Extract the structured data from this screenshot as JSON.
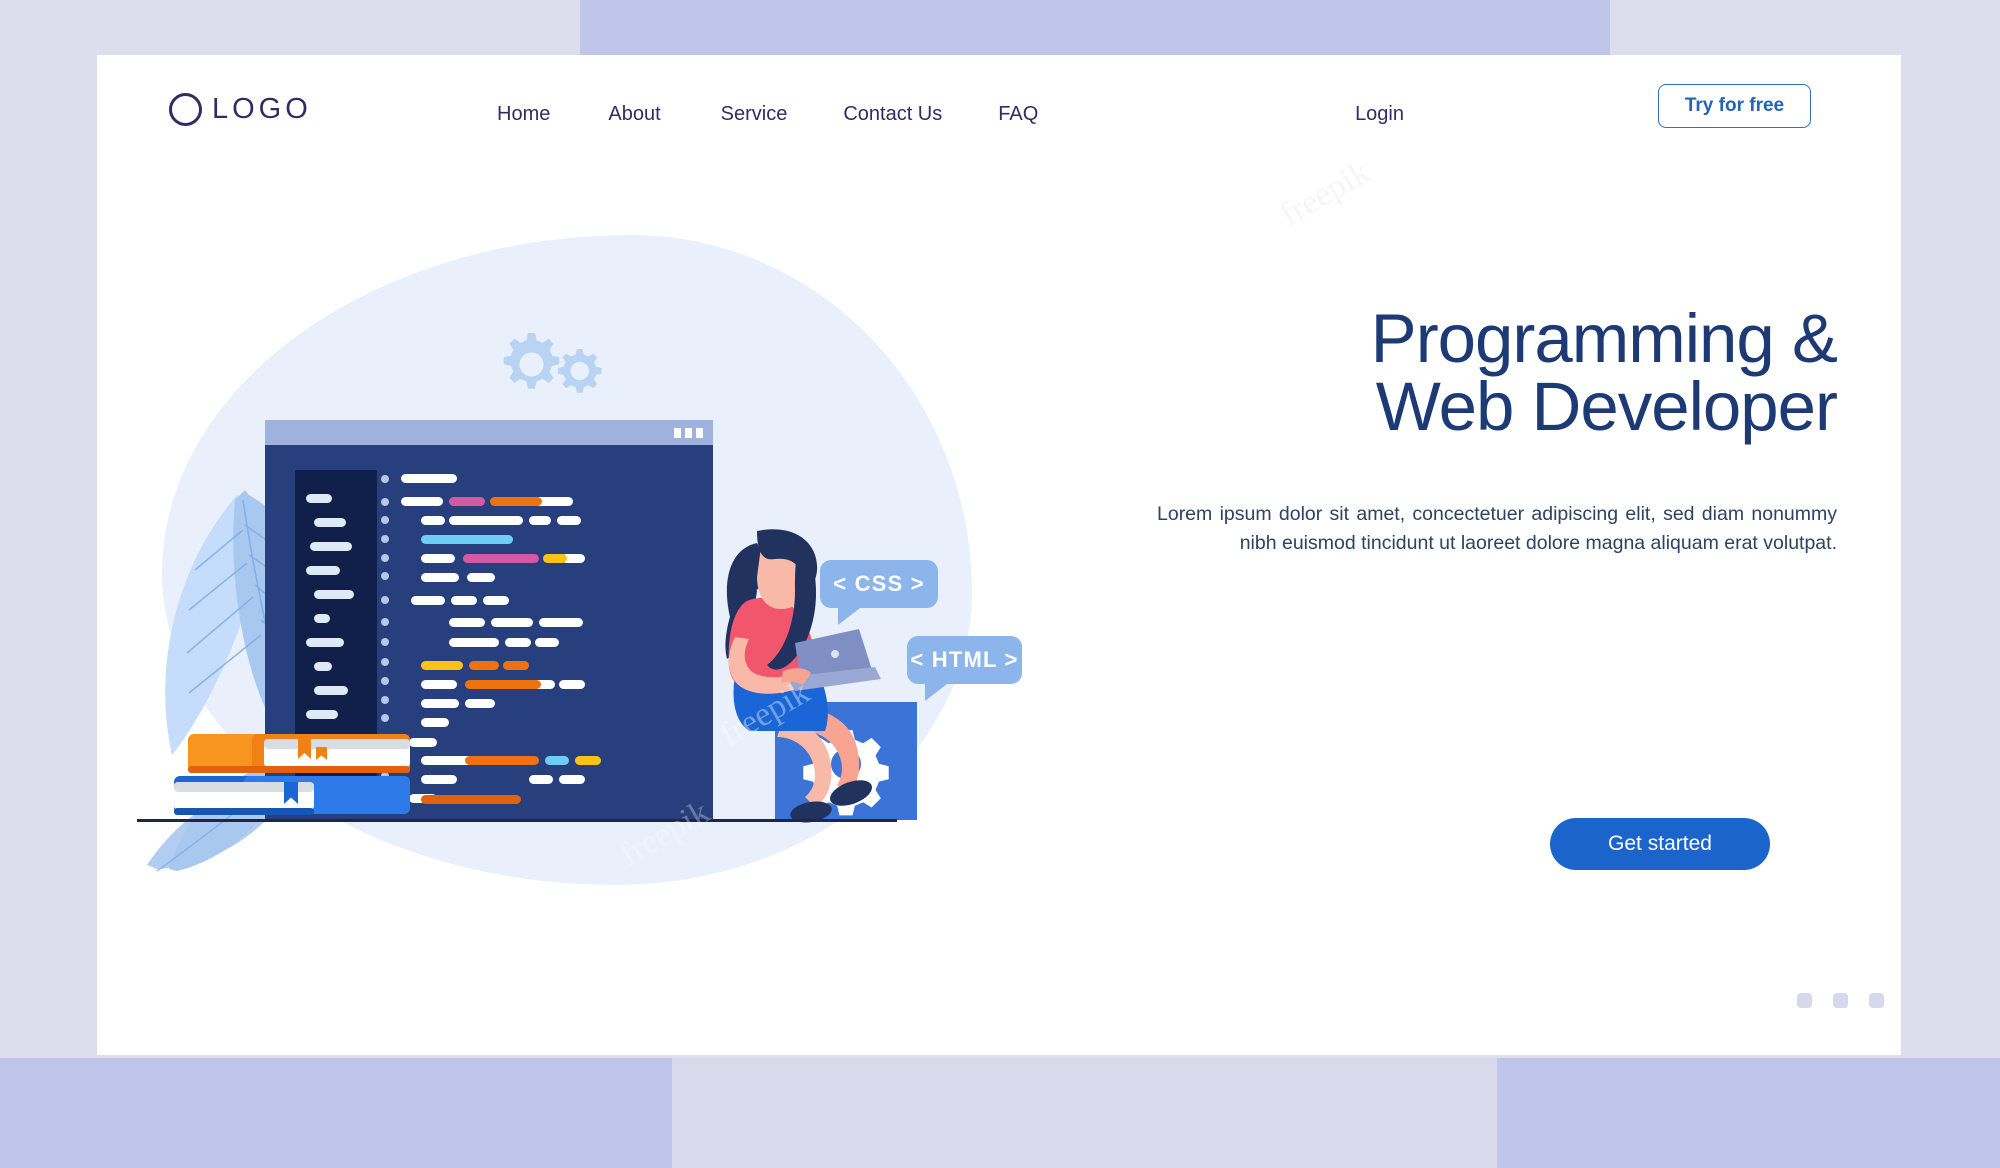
{
  "page": {
    "background_color": "#dcdeee",
    "card_color": "#ffffff"
  },
  "header": {
    "logo": {
      "text": "LOGO",
      "icon": "circle-outline-icon",
      "color": "#2e2d64"
    },
    "nav_items": [
      {
        "label": "Home"
      },
      {
        "label": "About"
      },
      {
        "label": "Service"
      },
      {
        "label": "Contact Us"
      },
      {
        "label": "FAQ"
      }
    ],
    "login_label": "Login",
    "try_button_label": "Try for free",
    "try_button_border_color": "#2f6fbf",
    "try_button_text_color": "#2463b5"
  },
  "hero": {
    "headline": "Programming &\nWeb Developer",
    "headline_color": "#1e3a74",
    "body": "Lorem ipsum dolor sit amet, concectetuer adipiscing elit, sed diam nonummy nibh euismod tincidunt ut laoreet dolore magna aliquam erat volutpat.",
    "cta_label": "Get started",
    "cta_color": "#1a64cc",
    "carousel_dots": 3,
    "carousel_dot_color": "#d6d8ec"
  },
  "illustration": {
    "blob_color": "#e9f0fb",
    "bubbles": [
      {
        "label": "< CSS >",
        "color": "#8cb5ec"
      },
      {
        "label": "< HTML >",
        "color": "#8cb5ec"
      }
    ],
    "code_window": {
      "titlebar_color": "#9fb2dd",
      "body_color": "#27407d",
      "sidebar_color": "#11204a",
      "window_dots": 3
    },
    "gear_box_color": "#3b74d6",
    "books": [
      {
        "name": "orange-book",
        "color": "#f79520"
      },
      {
        "name": "blue-book",
        "color": "#1a66d6"
      }
    ],
    "character": {
      "shirt_color": "#f1566d",
      "skirt_color": "#1a66d6",
      "hair_color": "#22325f",
      "skin_color": "#f7a592"
    },
    "leaf_color": "#a8c8f0",
    "gear_decoration_color": "#b9d3f3",
    "ground_line_color": "#1d2749"
  },
  "watermarks": [
    "freepik",
    "freepik",
    "freepik"
  ]
}
